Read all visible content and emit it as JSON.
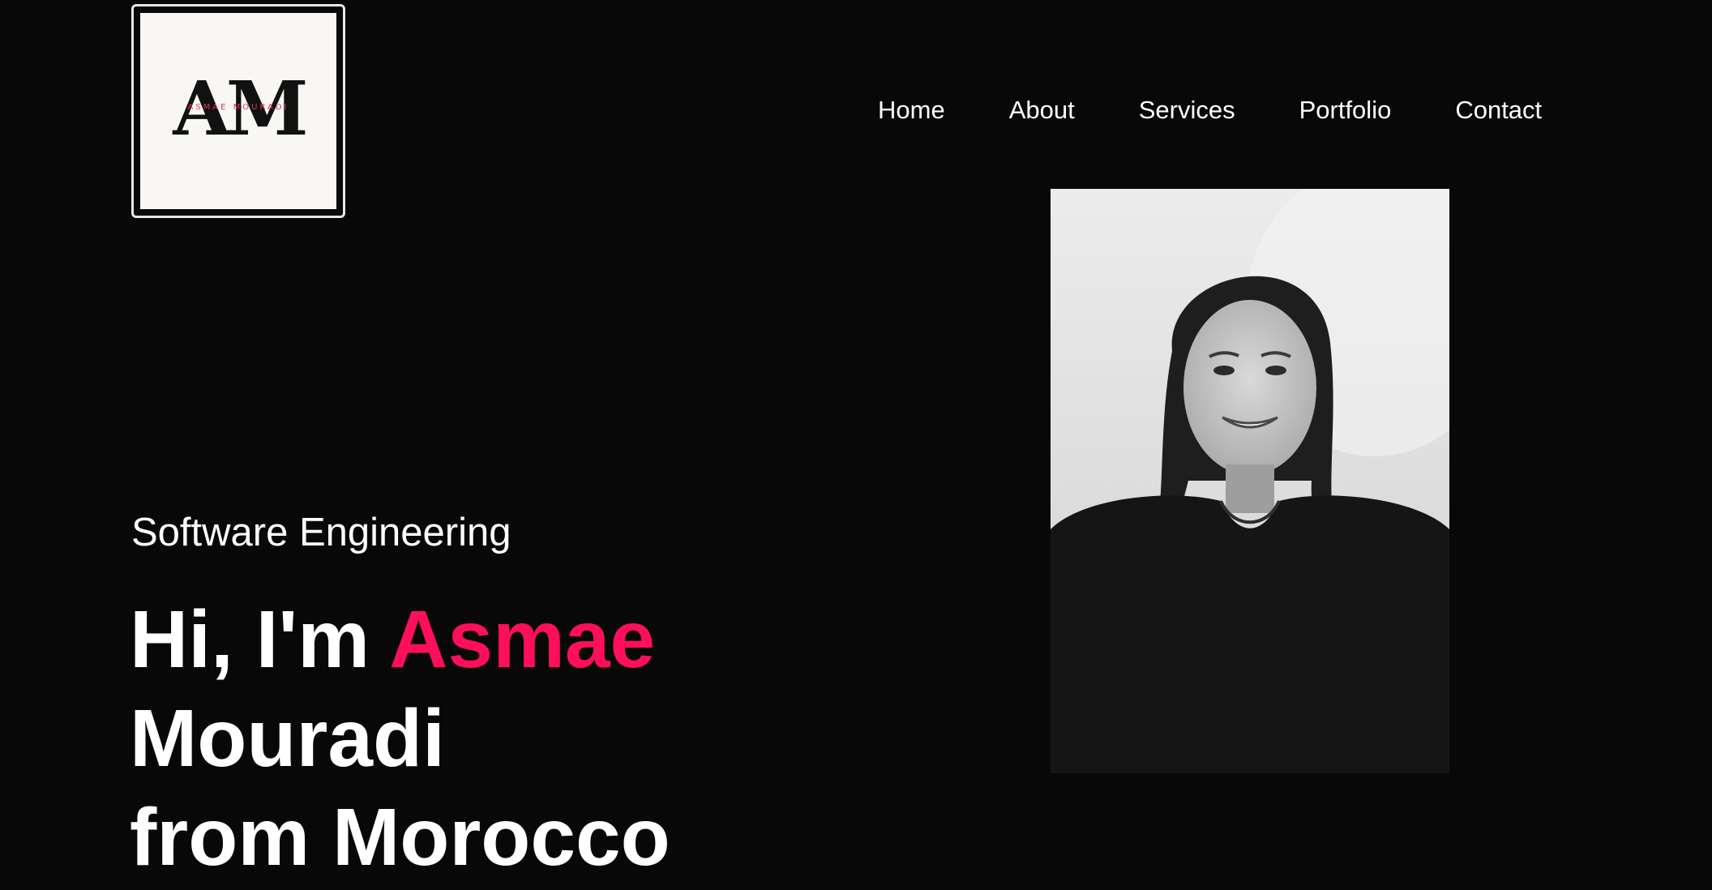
{
  "logo": {
    "monogram": "AM",
    "name": "ASMAE MOURADI"
  },
  "nav": {
    "items": [
      {
        "label": "Home"
      },
      {
        "label": "About"
      },
      {
        "label": "Services"
      },
      {
        "label": "Portfolio"
      },
      {
        "label": "Contact"
      }
    ]
  },
  "hero": {
    "subtitle": "Software Engineering",
    "greeting": "Hi, I'm ",
    "first_name": "Asmae",
    "last_name": "Mouradi",
    "origin": "from Morocco"
  },
  "colors": {
    "background": "#080808",
    "accent": "#ff0f5b",
    "text": "#ffffff"
  },
  "icons": {
    "portrait": "profile-photo"
  }
}
